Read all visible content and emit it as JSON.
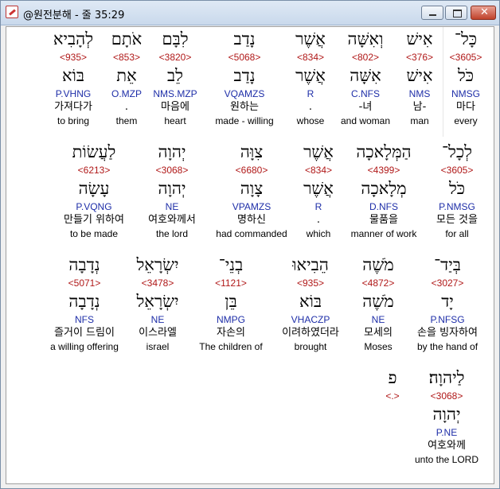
{
  "window": {
    "title": "@원전분해 - 줄 35:29"
  },
  "rows": [
    {
      "words": [
        {
          "heb": "כָּל־",
          "strong": "<3605>",
          "lemma": "כֹּל",
          "morph": "NMSG",
          "kor": "마다",
          "eng": "every"
        },
        {
          "heb": "אִישׁ",
          "strong": "<376>",
          "lemma": "אִישׁ",
          "morph": "NMS",
          "kor": "남-",
          "eng": "man"
        },
        {
          "heb": "וְאִשָּׁה",
          "strong": "<802>",
          "lemma": "אִשָּׁה",
          "morph": "C.NFS",
          "kor": "-녀",
          "eng": "and woman"
        },
        {
          "heb": "אֲשֶׁר",
          "strong": "<834>",
          "lemma": "אֲשֶׁר",
          "morph": "R",
          "kor": ".",
          "eng": "whose"
        },
        {
          "heb": "נָדַב",
          "strong": "<5068>",
          "lemma": "נָדַב",
          "morph": "VQAMZS",
          "kor": "원하는",
          "eng": "made - willing"
        },
        {
          "heb": "לִבָּם",
          "strong": "<3820>",
          "lemma": "לֵב",
          "morph": "NMS.MZP",
          "kor": "마음에",
          "eng": "heart"
        },
        {
          "heb": "אֹתָם",
          "strong": "<853>",
          "lemma": "אֵת",
          "morph": "O.MZP",
          "kor": ".",
          "eng": "them"
        },
        {
          "heb": "לְהָבִיא",
          "strong": "<935>",
          "lemma": "בּוֹא",
          "morph": "P.VHNG",
          "kor": "가져다가",
          "eng": "to bring"
        }
      ]
    },
    {
      "words": [
        {
          "heb": "לְכָל־",
          "strong": "<3605>",
          "lemma": "כֹּל",
          "morph": "P.NMSG",
          "kor": "모든 것을",
          "eng": "for all"
        },
        {
          "heb": "הַמְּלָאכָה",
          "strong": "<4399>",
          "lemma": "מְלָאכָה",
          "morph": "D.NFS",
          "kor": "물품을",
          "eng": "manner of work"
        },
        {
          "heb": "אֲשֶׁר",
          "strong": "<834>",
          "lemma": "אֲשֶׁר",
          "morph": "R",
          "kor": ".",
          "eng": "which"
        },
        {
          "heb": "צִוָּה",
          "strong": "<6680>",
          "lemma": "צָוָה",
          "morph": "VPAMZS",
          "kor": "명하신",
          "eng": "had commanded"
        },
        {
          "heb": "יְהוָה",
          "strong": "<3068>",
          "lemma": "יְהוָה",
          "morph": "NE",
          "kor": "여호와께서",
          "eng": "the lord"
        },
        {
          "heb": "לַעֲשׂוֹת",
          "strong": "<6213>",
          "lemma": "עָשָׂה",
          "morph": "P.VQNG",
          "kor": "만들기 위하여",
          "eng": "to be made"
        }
      ]
    },
    {
      "words": [
        {
          "heb": "בְּיַד־",
          "strong": "<3027>",
          "lemma": "יָד",
          "morph": "P.NFSG",
          "kor": "손을 빙자하여",
          "eng": "by the hand of"
        },
        {
          "heb": "מֹשֶׁה",
          "strong": "<4872>",
          "lemma": "מֹשֶׁה",
          "morph": "NE",
          "kor": "모세의",
          "eng": "Moses"
        },
        {
          "heb": "הֵבִיאוּ",
          "strong": "<935>",
          "lemma": "בּוֹא",
          "morph": "VHACZP",
          "kor": "이려하였더라",
          "eng": "brought"
        },
        {
          "heb": "בְנֵי־",
          "strong": "<1121>",
          "lemma": "בֵּן",
          "morph": "NMPG",
          "kor": "자손의",
          "eng": "The children of"
        },
        {
          "heb": "יִשְׂרָאֵל",
          "strong": "<3478>",
          "lemma": "יִשְׂרָאֵל",
          "morph": "NE",
          "kor": "이스라엘",
          "eng": "israel"
        },
        {
          "heb": "נְדָבָה",
          "strong": "<5071>",
          "lemma": "נְדָבָה",
          "morph": "NFS",
          "kor": "즐거이 드림이",
          "eng": "a willing offering"
        }
      ]
    },
    {
      "words": [
        {
          "heb": "לַיהוָה׃",
          "strong": "<3068>",
          "lemma": "יְהוָה",
          "morph": "P.NE",
          "kor": "여호와께",
          "eng": "unto the LORD"
        },
        {
          "heb": "פ",
          "strong": "<.>",
          "lemma": "",
          "morph": "",
          "kor": "",
          "eng": ""
        }
      ]
    }
  ]
}
